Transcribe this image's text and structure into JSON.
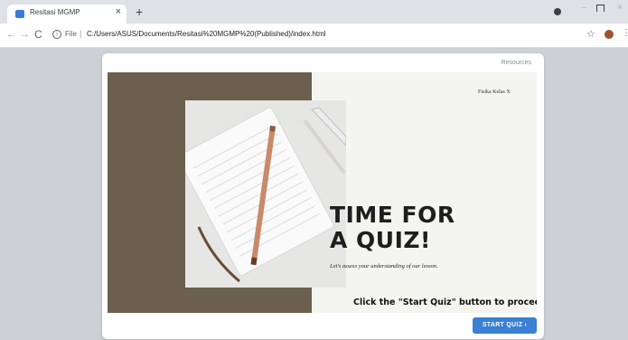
{
  "browser": {
    "tab_title": "Resitasi MGMP",
    "tab_close": "×",
    "new_tab": "+",
    "url_scheme": "File",
    "url_separator": "|",
    "url": "C:/Users/ASUS/Documents/Resitasi%20MGMP%20(Published)/index.html",
    "icons": {
      "back": "←",
      "forward": "→",
      "reload": "C",
      "info": "i",
      "star": "☆",
      "menu": "⋮",
      "minimize": "–",
      "close": "×"
    }
  },
  "page": {
    "resources_link": "Resources",
    "subject_label": "Fisika Kelas X",
    "title_line1": "TIME FOR",
    "title_line2": "A QUIZ!",
    "subtitle": "Let's assess your understanding of our lesson.",
    "instruction": "Click the \"Start Quiz\" button to proceed",
    "start_button": "START QUIZ ›"
  },
  "colors": {
    "accent": "#3a80d4",
    "panel": "#6b5f4d",
    "slide_bg": "#f4f4f0"
  }
}
